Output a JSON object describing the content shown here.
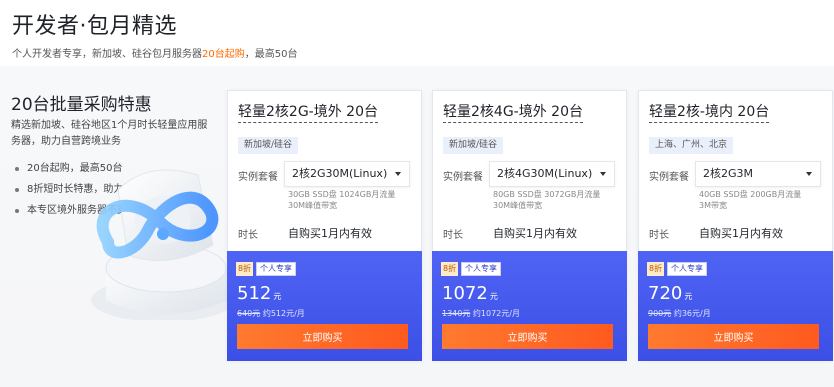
{
  "header": {
    "title": "开发者·包月精选",
    "subtitle_pre": "个人开发者专享，新加坡、硅谷包月服务器",
    "subtitle_highlight": "20台起购",
    "subtitle_post": "，最高50台"
  },
  "promo": {
    "title": "20台批量采购特惠",
    "desc": "精选新加坡、硅谷地区1个月时长轻量应用服务器，助力自营跨境业务",
    "bullets": [
      "20台起购，最高50台",
      "8折短时长特惠，助力开发者创业",
      "本专区境外服务器不支持代金券抵扣"
    ]
  },
  "labels": {
    "spec": "实例套餐",
    "duration": "时长"
  },
  "cards": [
    {
      "title": "轻量2核2G-境外 20台",
      "region": "新加坡/硅谷",
      "spec_value": "2核2G30M(Linux)",
      "spec_detail_1": "30GB SSD盘 1024GB月流量",
      "spec_detail_2": "30M峰值带宽",
      "duration": "自购买1月内有效",
      "discount": "8折",
      "tag": "个人专享",
      "price": "512",
      "unit": "元",
      "orig_price": "640元",
      "per_unit": "约512元/月",
      "buy": "立即购买"
    },
    {
      "title": "轻量2核4G-境外 20台",
      "region": "新加坡/硅谷",
      "spec_value": "2核4G30M(Linux)",
      "spec_detail_1": "80GB SSD盘 3072GB月流量",
      "spec_detail_2": "30M峰值带宽",
      "duration": "自购买1月内有效",
      "discount": "8折",
      "tag": "个人专享",
      "price": "1072",
      "unit": "元",
      "orig_price": "1340元",
      "per_unit": "约1072元/月",
      "buy": "立即购买"
    },
    {
      "title": "轻量2核-境内 20台",
      "region": "上海、广州、北京",
      "spec_value": "2核2G3M",
      "spec_detail_1": "40GB SSD盘 200GB月流量",
      "spec_detail_2": "3M带宽",
      "duration": "自购买1月内有效",
      "discount": "8折",
      "tag": "个人专享",
      "price": "720",
      "unit": "元",
      "orig_price": "900元",
      "per_unit": "约36元/月",
      "buy": "立即购买"
    }
  ],
  "colors": {
    "accent_orange": "#ff6a00",
    "price_blue": "#4f63f4",
    "buy_orange": "#ff6b28"
  }
}
